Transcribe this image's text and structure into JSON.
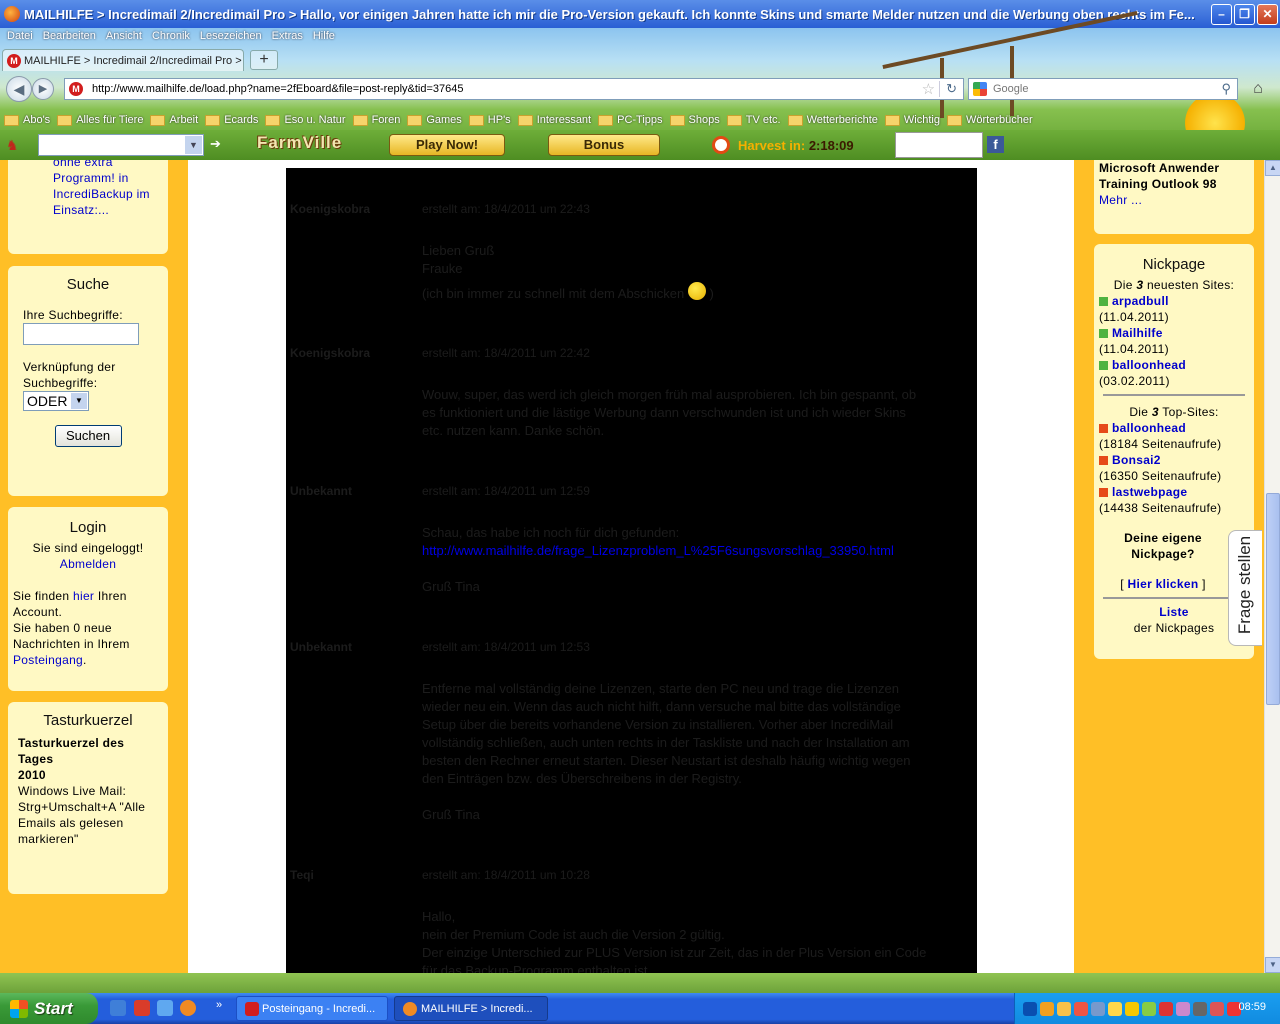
{
  "window": {
    "title": "MAILHILFE > Incredimail 2/Incredimail Pro > Hallo, vor einigen Jahren hatte ich mir die Pro-Version gekauft. Ich konnte Skins und smarte Melder nutzen und die Werbung oben rechts im Fe..."
  },
  "menu": [
    "Datei",
    "Bearbeiten",
    "Ansicht",
    "Chronik",
    "Lesezeichen",
    "Extras",
    "Hilfe"
  ],
  "tab": {
    "label": "MAILHILFE > Incredimail 2/Incredimail Pro >"
  },
  "nav": {
    "url": "http://www.mailhilfe.de/load.php?name=2fEboard&file=post-reply&tid=37645",
    "search_placeholder": "Google"
  },
  "bookmarks": [
    "Abo's",
    "Alles für Tiere",
    "Arbeit",
    "Ecards",
    "Eso u. Natur",
    "Foren",
    "Games",
    "HP's",
    "Interessant",
    "PC-Tipps",
    "Shops",
    "TV etc.",
    "Wetterberichte",
    "Wichtig",
    "Wörterbücher"
  ],
  "farmbar": {
    "logo": "FarmVille",
    "play_now": "Play Now!",
    "bonus": "Bonus",
    "harvest_label": "Harvest in:",
    "harvest_time": "2:18:09"
  },
  "left": {
    "teaser": [
      "ohne extra",
      "Programm! in",
      "IncrediBackup im",
      "Einsatz:..."
    ],
    "search": {
      "title": "Suche",
      "terms_label": "Ihre Suchbegriffe:",
      "link_label_1": "Verknüpfung der",
      "link_label_2": "Suchbegriffe:",
      "link_value": "ODER",
      "button": "Suchen"
    },
    "login": {
      "title": "Login",
      "status": "Sie sind eingeloggt!",
      "logout": "Abmelden",
      "account_pre": "Sie finden ",
      "account_link": "hier",
      "account_post": " Ihren",
      "account_line2": "Account.",
      "messages_1": "Sie haben 0 neue",
      "messages_2": "Nachrichten in Ihrem",
      "inbox": "Posteingang",
      "inbox_dot": "."
    },
    "shortcut": {
      "title": "Tasturkuerzel",
      "bold_1": "Tasturkuerzel des",
      "bold_2": "Tages",
      "bold_3": "2010",
      "lines": [
        "Windows Live Mail:",
        "Strg+Umschalt+A \"Alle",
        "Emails als gelesen",
        "markieren\""
      ]
    }
  },
  "posts": [
    {
      "author": "Koenigskobra",
      "date": "erstellt am: 18/4/2011 um 22:43",
      "lines": [
        "Lieben Gruß",
        "Frauke",
        "(ich bin immer zu schnell mit dem Abschicken"
      ],
      "tail": ")"
    },
    {
      "author": "Koenigskobra",
      "date": "erstellt am: 18/4/2011 um 22:42",
      "lines": [
        "Wouw, super, das werd ich gleich morgen früh mal ausprobieren. Ich bin gespannt, ob",
        "es funktioniert und die lästige Werbung dann verschwunden ist und ich wieder Skins",
        "etc. nutzen kann. Danke schön."
      ]
    },
    {
      "author": "Unbekannt",
      "date": "erstellt am: 18/4/2011 um 12:59",
      "lines": [
        "Schau, das habe ich noch für dich gefunden:"
      ],
      "link": "http://www.mailhilfe.de/frage_Lizenzproblem_L%25F6sungsvorschlag_33950.html",
      "sign": "Gruß Tina"
    },
    {
      "author": "Unbekannt",
      "date": "erstellt am: 18/4/2011 um 12:53",
      "lines": [
        "Entferne mal vollständig deine Lizenzen, starte den PC neu und trage die Lizenzen",
        "wieder neu ein. Wenn das auch nicht hilft, dann versuche mal bitte das vollständige",
        "Setup über die bereits vorhandene Version zu installieren. Vorher aber IncrediMail",
        "vollständig schließen, auch unten rechts in der Taskliste und nach der Installation am",
        "besten den Rechner erneut starten. Dieser Neustart ist deshalb häufig wichtig wegen",
        "den Einträgen bzw. des Überschreibens in der Registry."
      ],
      "sign": "Gruß Tina"
    },
    {
      "author": "Teqi",
      "date": "erstellt am: 18/4/2011 um 10:28",
      "lines": [
        "Hallo,",
        "nein der Premium Code ist auch die Version 2 gültig.",
        "Der einzige Unterschied zur PLUS Version ist zur Zeit, das in der Plus Version ein Code",
        "für das Backup-Programm enthalten ist."
      ]
    }
  ],
  "right": {
    "ad": [
      "Microsoft Anwender",
      "Training Outlook 98"
    ],
    "ad_more": "Mehr ...",
    "nick": {
      "title": "Nickpage",
      "newest_pre": "Die ",
      "newest_count": "3",
      "newest_post": " neuesten Sites:",
      "newest": [
        {
          "name": "arpadbull",
          "date": "(11.04.2011)"
        },
        {
          "name": "Mailhilfe",
          "date": "(11.04.2011)"
        },
        {
          "name": "balloonhead",
          "date": "(03.02.2011)"
        }
      ],
      "top_pre": "Die ",
      "top_count": "3",
      "top_post": " Top-Sites:",
      "top": [
        {
          "name": "balloonhead",
          "views": "(18184 Seitenaufrufe)"
        },
        {
          "name": "Bonsai2",
          "views": "(16350 Seitenaufrufe)"
        },
        {
          "name": "lastwebpage",
          "views": "(14438 Seitenaufrufe)"
        }
      ],
      "own_1": "Deine eigene",
      "own_2": "Nickpage?",
      "click_open": "[ ",
      "click": "Hier klicken",
      "click_close": " ]",
      "list": "Liste",
      "list_sub": "der Nickpages"
    },
    "frage": "Frage stellen"
  },
  "taskbar": {
    "start": "Start",
    "tasks": [
      "Posteingang - Incredi...",
      "MAILHILFE > Incredi..."
    ],
    "time": "08:59"
  }
}
